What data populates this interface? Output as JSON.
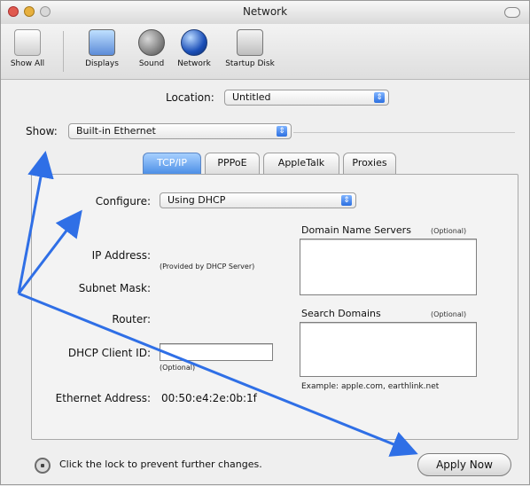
{
  "window": {
    "title": "Network"
  },
  "toolbar": {
    "items": [
      {
        "label": "Show All",
        "icon": "show-all-icon"
      },
      {
        "label": "Displays",
        "icon": "displays-icon"
      },
      {
        "label": "Sound",
        "icon": "sound-icon"
      },
      {
        "label": "Network",
        "icon": "network-icon"
      },
      {
        "label": "Startup Disk",
        "icon": "startup-disk-icon"
      }
    ]
  },
  "location": {
    "label": "Location:",
    "value": "Untitled"
  },
  "show": {
    "label": "Show:",
    "value": "Built-in Ethernet"
  },
  "tabs": [
    {
      "label": "TCP/IP",
      "active": true
    },
    {
      "label": "PPPoE",
      "active": false
    },
    {
      "label": "AppleTalk",
      "active": false
    },
    {
      "label": "Proxies",
      "active": false
    }
  ],
  "tcpip": {
    "configure": {
      "label": "Configure:",
      "value": "Using DHCP"
    },
    "ip_address": {
      "label": "IP Address:"
    },
    "provided_note": "(Provided by DHCP Server)",
    "subnet_mask": {
      "label": "Subnet Mask:"
    },
    "router": {
      "label": "Router:"
    },
    "dhcp_client_id": {
      "label": "DHCP Client ID:",
      "value": "",
      "optional": "(Optional)"
    },
    "ethernet_address": {
      "label": "Ethernet Address:",
      "value": "00:50:e4:2e:0b:1f"
    },
    "dns": {
      "title": "Domain Name Servers",
      "optional": "(Optional)",
      "value": ""
    },
    "search_domains": {
      "title": "Search Domains",
      "optional": "(Optional)",
      "value": "",
      "example": "Example: apple.com, earthlink.net"
    }
  },
  "footer": {
    "lock_text": "Click the lock to prevent further changes.",
    "apply_label": "Apply Now"
  },
  "annotations": {
    "arrow_color": "#2f6fe6"
  }
}
